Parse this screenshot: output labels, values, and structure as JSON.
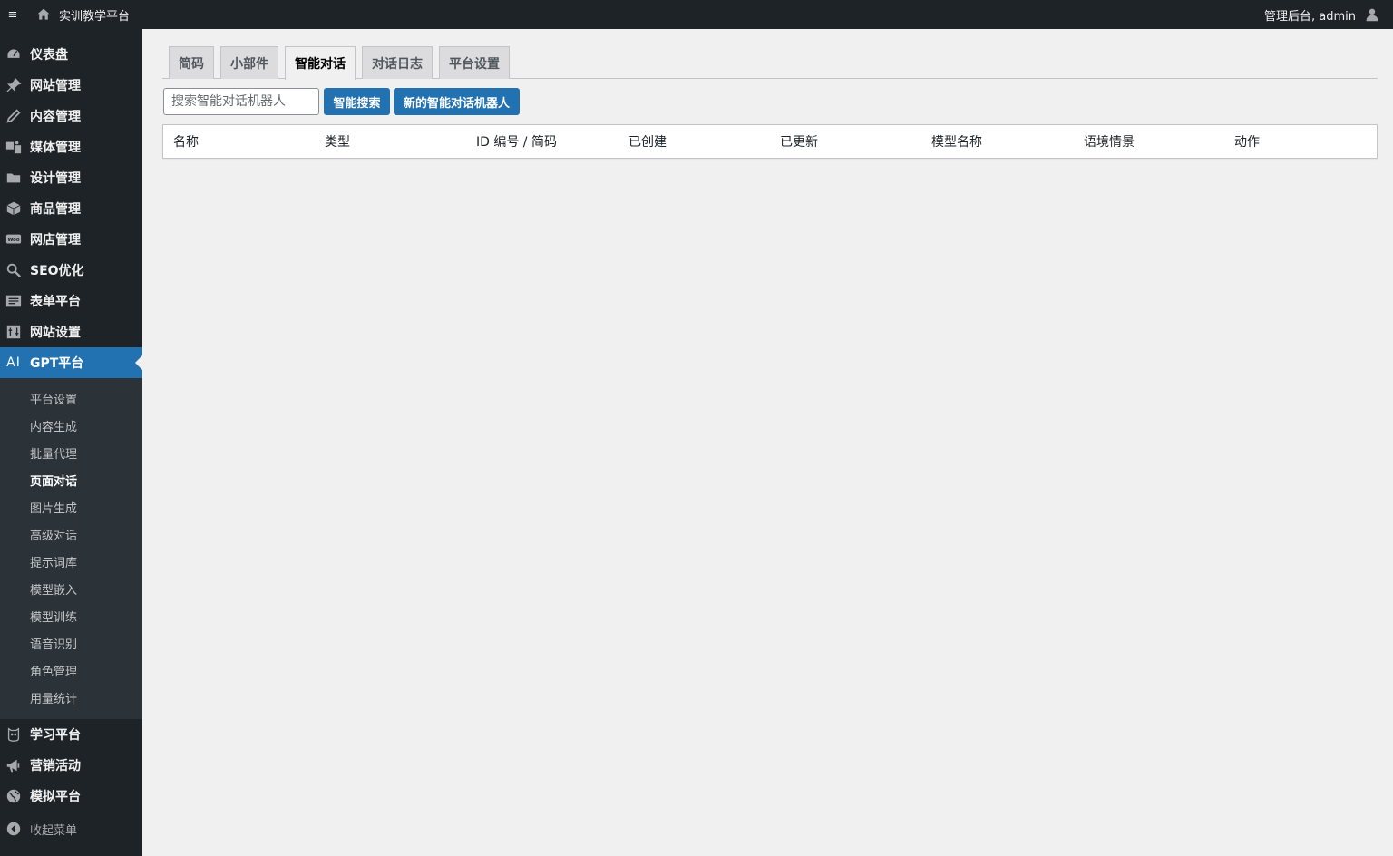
{
  "topbar": {
    "menu_icon": "≡",
    "site_name": "实训教学平台",
    "greeting": "管理后台, admin"
  },
  "sidebar": {
    "items": [
      {
        "label": "仪表盘",
        "icon": "dashboard-icon"
      },
      {
        "label": "网站管理",
        "icon": "pin-icon"
      },
      {
        "label": "内容管理",
        "icon": "edit-icon"
      },
      {
        "label": "媒体管理",
        "icon": "media-icon"
      },
      {
        "label": "设计管理",
        "icon": "folder-icon"
      },
      {
        "label": "商品管理",
        "icon": "box-icon"
      },
      {
        "label": "网店管理",
        "icon": "woo-icon"
      },
      {
        "label": "SEO优化",
        "icon": "search-icon"
      },
      {
        "label": "表单平台",
        "icon": "form-icon"
      },
      {
        "label": "网站设置",
        "icon": "settings-icon"
      }
    ],
    "active_item": {
      "icon_text": "AI",
      "label": "GPT平台"
    },
    "submenu": [
      "平台设置",
      "内容生成",
      "批量代理",
      "页面对话",
      "图片生成",
      "高级对话",
      "提示词库",
      "模型嵌入",
      "模型训练",
      "语音识别",
      "角色管理",
      "用量统计"
    ],
    "current_sub": "页面对话",
    "after_items": [
      {
        "label": "学习平台",
        "icon": "owl-icon"
      },
      {
        "label": "营销活动",
        "icon": "megaphone-icon"
      },
      {
        "label": "模拟平台",
        "icon": "globe-icon"
      }
    ],
    "collapse_label": "收起菜单"
  },
  "tabs": [
    "简码",
    "小部件",
    "智能对话",
    "对话日志",
    "平台设置"
  ],
  "active_tab": "智能对话",
  "search": {
    "placeholder": "搜索智能对话机器人",
    "value": ""
  },
  "buttons": {
    "search": "智能搜索",
    "new_bot": "新的智能对话机器人"
  },
  "table": {
    "columns": [
      "名称",
      "类型",
      "ID 编号 / 简码",
      "已创建",
      "已更新",
      "模型名称",
      "语境情景",
      "动作"
    ]
  },
  "colors": {
    "accent": "#2271b1",
    "sidebar_bg": "#1d2327",
    "submenu_bg": "#2c3338",
    "page_bg": "#f0f0f1"
  }
}
